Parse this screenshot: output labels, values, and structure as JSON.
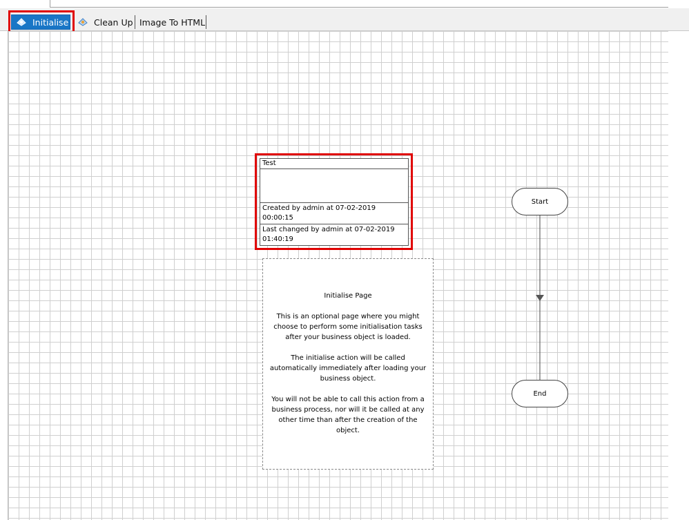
{
  "tabs": [
    {
      "label": "Initialise",
      "active": true
    },
    {
      "label": "Clean Up",
      "active": false
    },
    {
      "label": "Image To HTML",
      "active": false
    }
  ],
  "info_box": {
    "title": "Test",
    "created": "Created by admin at 07-02-2019 00:00:15",
    "changed": "Last changed by admin at 07-02-2019 01:40:19"
  },
  "note": {
    "heading": "Initialise Page",
    "paragraph_1": "This is an optional page where you might choose to perform some initialisation tasks after your business object is loaded.",
    "paragraph_2": "The initialise action will be called automatically immediately after loading your business object.",
    "paragraph_3": "You will not be able to call this action from a business process, nor will it be called at any other time than after the creation of the object."
  },
  "flow": {
    "start_label": "Start",
    "end_label": "End"
  },
  "colors": {
    "active_tab": "#1976c6",
    "highlight": "#e00000",
    "grid": "#cfcfcf"
  },
  "icons": {
    "tab_icon": "page-gears-icon",
    "flow_arrow": "arrow-down-icon"
  }
}
